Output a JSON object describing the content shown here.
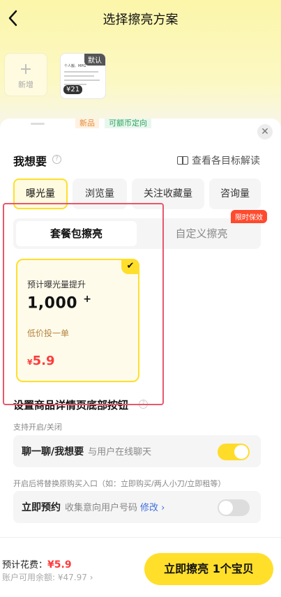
{
  "header": {
    "back_icon": "chevron-left-icon",
    "title": "选择擦亮方案"
  },
  "products": {
    "add_label": "新增",
    "item": {
      "default_badge": "默认",
      "price": "¥21",
      "snippet": "个人搬、MPG"
    }
  },
  "peek_tags": [
    "新品",
    "可额币定向"
  ],
  "want": {
    "label": "我想要",
    "goals_link": "查看各目标解读",
    "tabs": [
      "曝光量",
      "浏览量",
      "关注收藏量",
      "咨询量"
    ],
    "active_tab": 0
  },
  "package_switch": {
    "package_label": "套餐包擦亮",
    "custom_label": "自定义擦亮",
    "limited_badge": "限时保效"
  },
  "package_card": {
    "expect_label": "预计曝光量提升",
    "value": "1,000",
    "value_suffix": "+",
    "subtitle": "低价投一单",
    "currency": "¥",
    "price": "5.9",
    "selected": true
  },
  "bottom_button": {
    "title": "设置商品详情页底部按钮",
    "note_toggle": "支持开启/关闭",
    "chat": {
      "name": "聊一聊/我想要",
      "desc": "与用户在线聊天",
      "enabled": true
    },
    "note_replace": "开启后将替换原购买入口（如：立即购买/两人小刀/立即租等）",
    "reserve": {
      "name": "立即预约",
      "desc": "收集意向用户号码",
      "modify": "修改",
      "enabled": false
    }
  },
  "footer": {
    "cost_label": "预计花费：",
    "cost_value": "¥5.9",
    "balance_label": "账户可用余额: ¥47.97",
    "cta": "立即擦亮 1个宝贝"
  },
  "colors": {
    "accent": "#ffdf2a",
    "price": "#ff3b3b",
    "highlight": "#e9566b",
    "link": "#3f6fe0"
  }
}
